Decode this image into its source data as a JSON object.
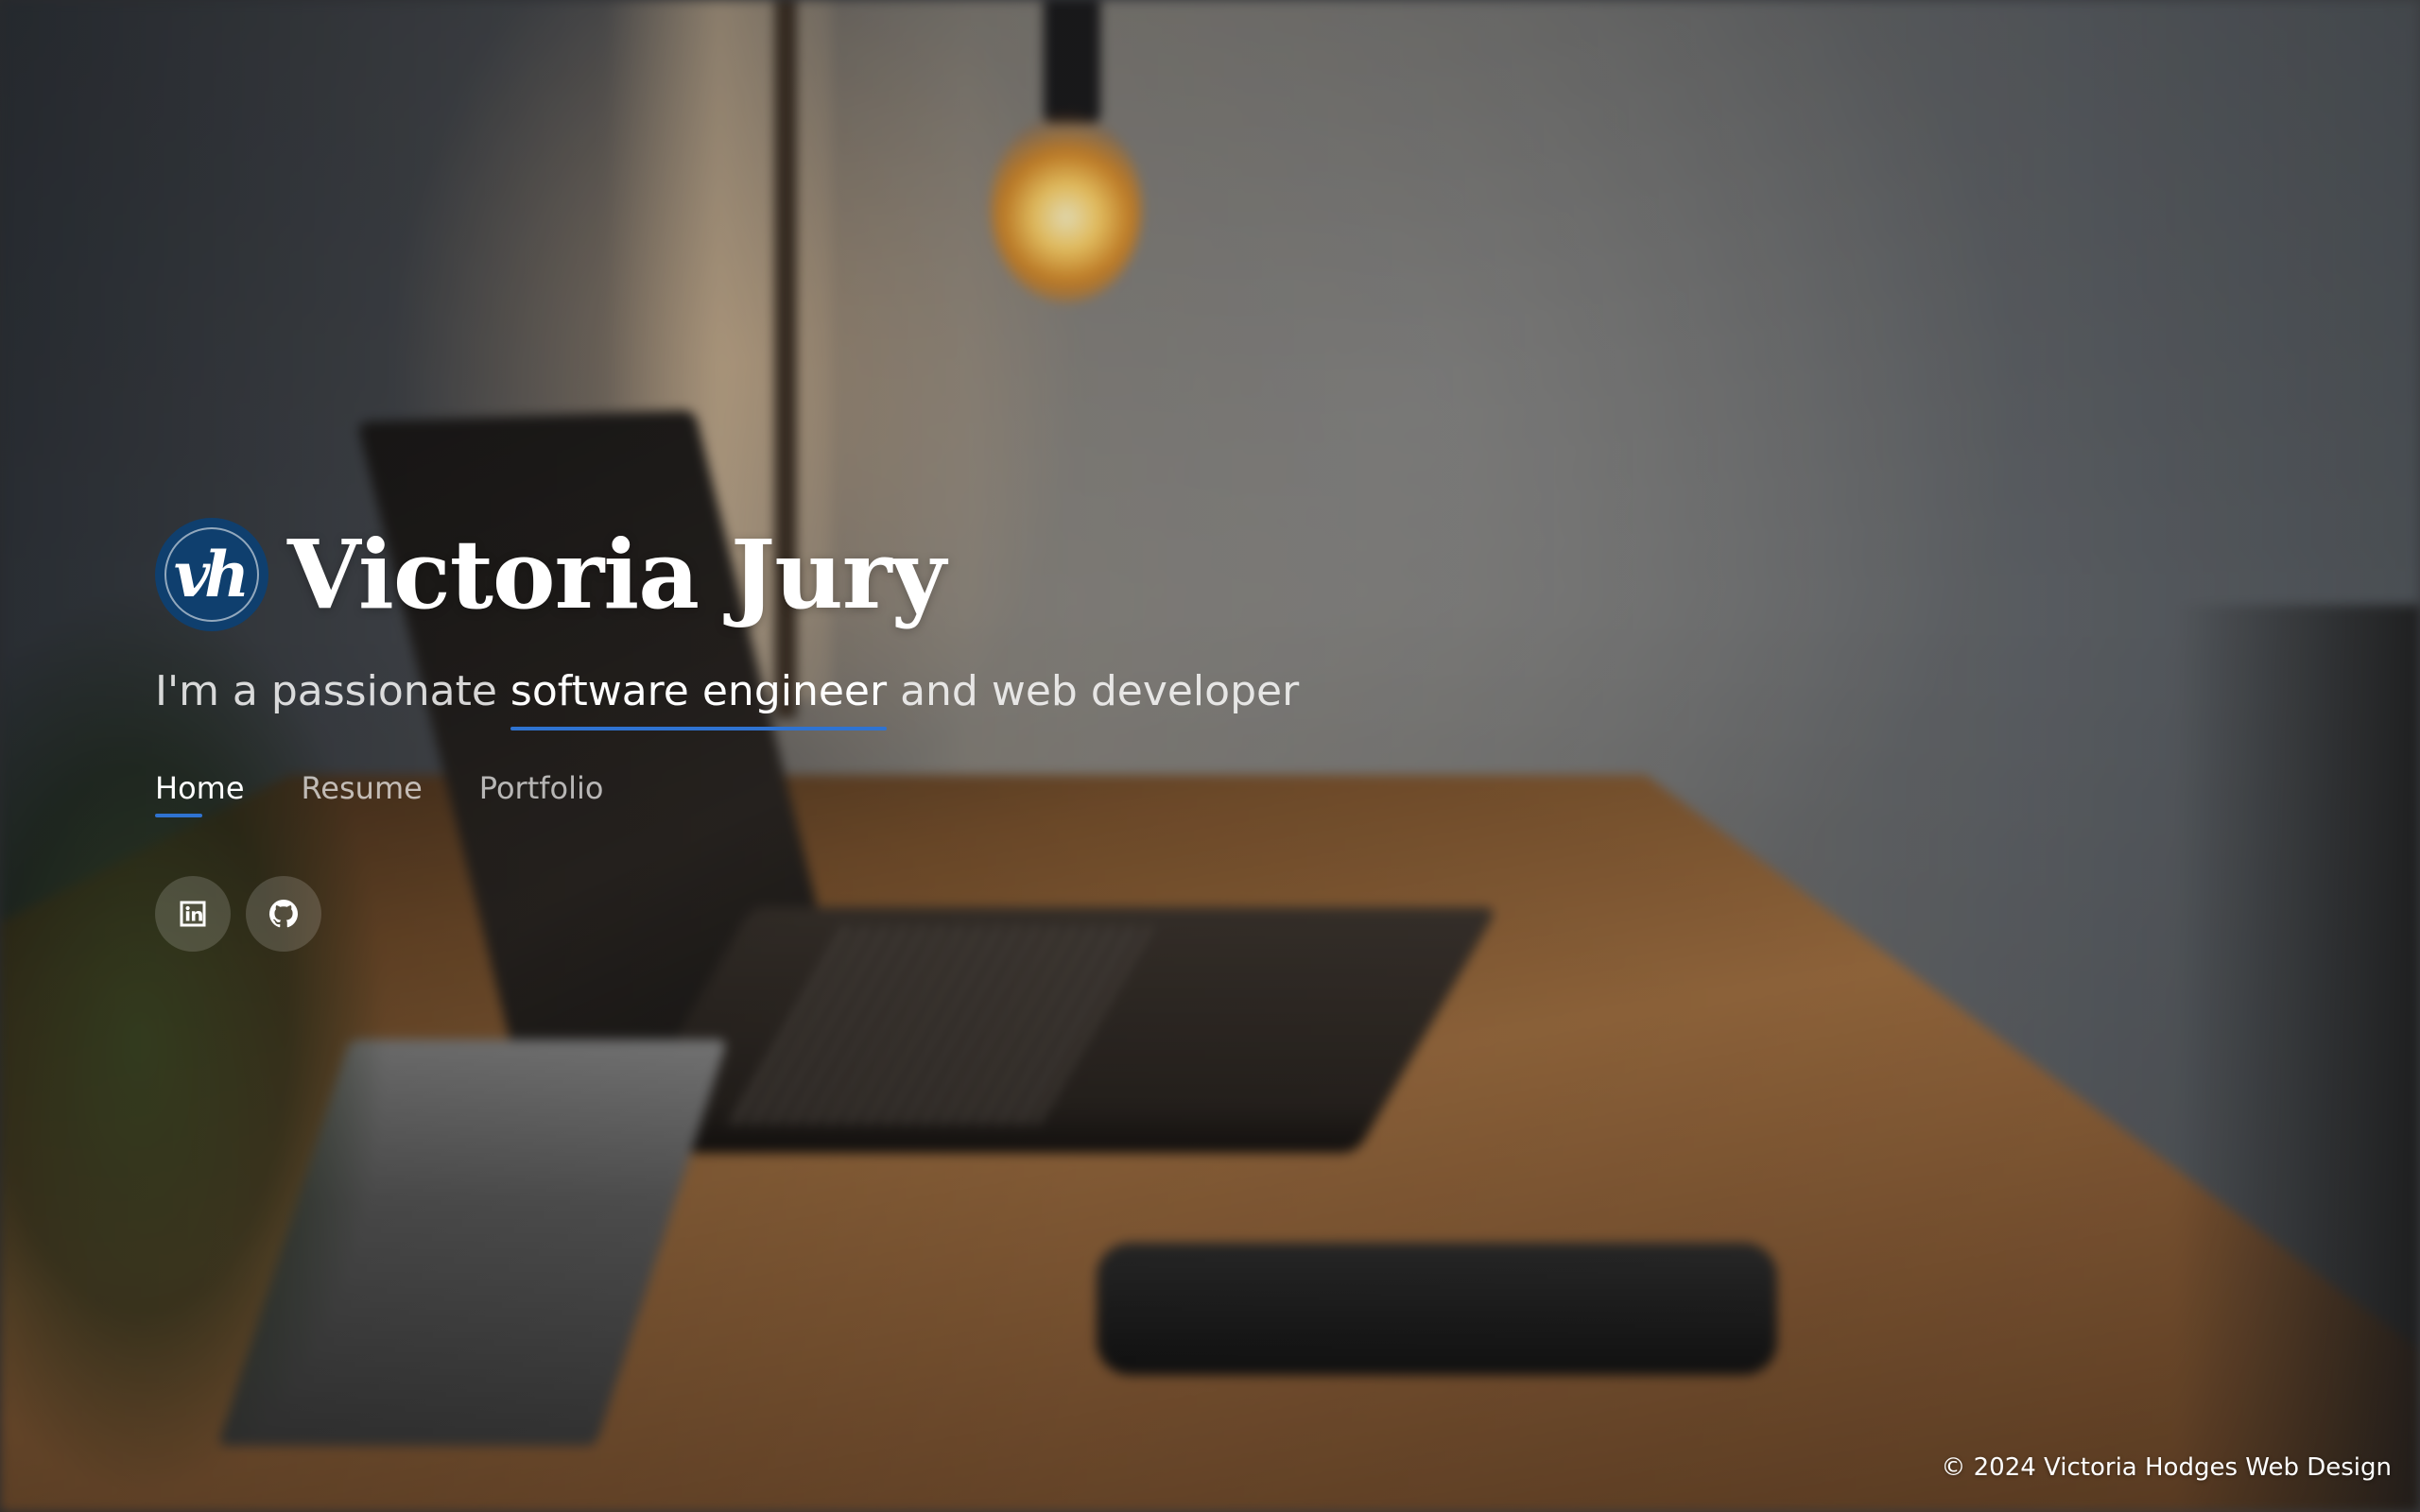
{
  "site": {
    "logo_text": "vh",
    "name": "Victoria Jury"
  },
  "tagline": {
    "prefix": "I'm a passionate ",
    "highlight": "software engineer",
    "suffix": " and web developer",
    "accent_color": "#2f73d1"
  },
  "nav": {
    "items": [
      {
        "label": "Home",
        "active": true
      },
      {
        "label": "Resume",
        "active": false
      },
      {
        "label": "Portfolio",
        "active": false
      }
    ]
  },
  "social": {
    "items": [
      {
        "icon": "linkedin-icon"
      },
      {
        "icon": "github-icon"
      }
    ]
  },
  "footer": {
    "text": "© 2024 Victoria Hodges Web Design"
  },
  "colors": {
    "logo_background": "#0f3f6e",
    "accent": "#2f73d1"
  }
}
